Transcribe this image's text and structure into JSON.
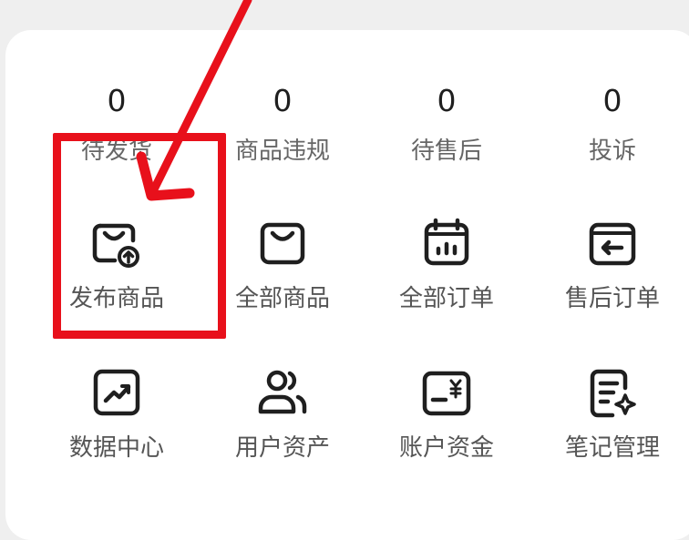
{
  "stats": [
    {
      "value": "0",
      "label": "待发货"
    },
    {
      "value": "0",
      "label": "商品违规"
    },
    {
      "value": "0",
      "label": "待售后"
    },
    {
      "value": "0",
      "label": "投诉"
    }
  ],
  "tools": [
    {
      "label": "发布商品",
      "icon": "bag-upload-icon"
    },
    {
      "label": "全部商品",
      "icon": "shopping-bag-icon"
    },
    {
      "label": "全部订单",
      "icon": "order-chart-icon"
    },
    {
      "label": "售后订单",
      "icon": "return-arrow-icon"
    },
    {
      "label": "数据中心",
      "icon": "trend-chart-icon"
    },
    {
      "label": "用户资产",
      "icon": "users-icon"
    },
    {
      "label": "账户资金",
      "icon": "yuan-card-icon"
    },
    {
      "label": "笔记管理",
      "icon": "note-sparkle-icon"
    }
  ],
  "colors": {
    "highlight": "#e8101b",
    "icon": "#1f1f1f",
    "label": "#555555"
  }
}
